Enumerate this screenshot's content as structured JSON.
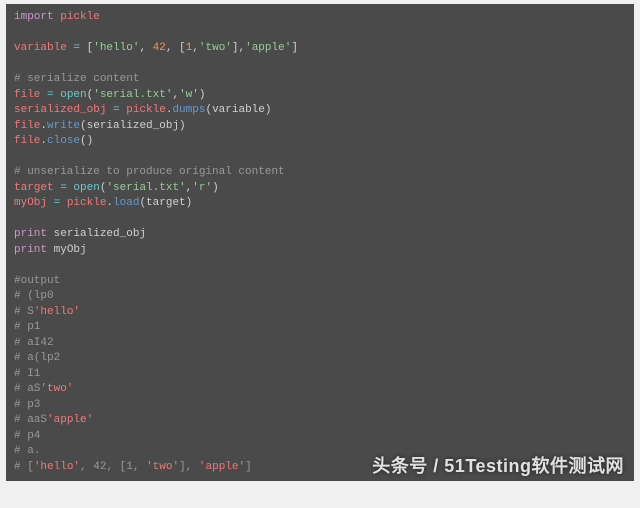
{
  "lines": {
    "l0_import": "import",
    "l0_pickle": "pickle",
    "l2_var": "variable",
    "l2_eq": " = ",
    "l2_open": "[",
    "l2_s1": "'hello'",
    "l2_c1": ", ",
    "l2_n1": "42",
    "l2_c2": ", [",
    "l2_n2": "1",
    "l2_c3": ",",
    "l2_s2": "'two'",
    "l2_c4": "],",
    "l2_s3": "'apple'",
    "l2_close": "]",
    "l4_cmt": "# serialize content",
    "l5_var": "file",
    "l5_eq": " = ",
    "l5_fn": "open",
    "l5_args_a": "(",
    "l5_s1": "'serial.txt'",
    "l5_c": ",",
    "l5_s2": "'w'",
    "l5_args_b": ")",
    "l6_var": "serialized_obj",
    "l6_eq": " = ",
    "l6_mod": "pickle",
    "l6_dot": ".",
    "l6_fn": "dumps",
    "l6_args": "(variable)",
    "l7_obj": "file",
    "l7_dot": ".",
    "l7_fn": "write",
    "l7_args": "(serialized_obj)",
    "l8_obj": "file",
    "l8_dot": ".",
    "l8_fn": "close",
    "l8_args": "()",
    "l10_cmt": "# unserialize to produce original content",
    "l11_var": "target",
    "l11_eq": " = ",
    "l11_fn": "open",
    "l11_args_a": "(",
    "l11_s1": "'serial.txt'",
    "l11_c": ",",
    "l11_s2": "'r'",
    "l11_args_b": ")",
    "l12_var": "myObj",
    "l12_eq": " = ",
    "l12_mod": "pickle",
    "l12_dot": ".",
    "l12_fn": "load",
    "l12_args": "(target)",
    "l14_print": "print",
    "l14_arg": " serialized_obj",
    "l15_print": "print",
    "l15_arg": " myObj",
    "l17_cmt": "#output",
    "o1": "# (lp0",
    "o2a": "# S",
    "o2b": "'hello'",
    "o3": "# p1",
    "o4": "# aI42",
    "o5": "# a(lp2",
    "o6": "# I1",
    "o7a": "# aS",
    "o7b": "'two'",
    "o8": "# p3",
    "o9a": "# aaS",
    "o9b": "'apple'",
    "o10": "# p4",
    "o11": "# a.",
    "oF_a": "# [",
    "oF_s1": "'hello'",
    "oF_c1": ", ",
    "oF_n1": "42",
    "oF_c2": ", [",
    "oF_n2": "1",
    "oF_c3": ", ",
    "oF_s2": "'two'",
    "oF_c4": "], ",
    "oF_s3": "'apple'",
    "oF_b": "]"
  },
  "watermark": "头条号 / 51Testing软件测试网"
}
